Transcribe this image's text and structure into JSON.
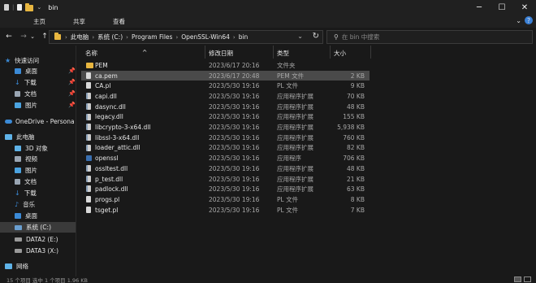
{
  "window": {
    "title": "bin",
    "controls": [
      "─",
      "☐",
      "✕"
    ]
  },
  "ribbon": {
    "tabs": [
      "主页",
      "共享",
      "查看"
    ],
    "expand": "⌄"
  },
  "nav": {
    "back": "←",
    "forward": "→",
    "recent": "⌄",
    "up": "↑",
    "breadcrumbs": [
      "此电脑",
      "系统 (C:)",
      "Program Files",
      "OpenSSL-Win64",
      "bin"
    ],
    "search_placeholder": "在 bin 中搜索"
  },
  "sidebar": {
    "quick_access": "快速访问",
    "pinned": [
      {
        "label": "桌面",
        "color": "#3b8ad6"
      },
      {
        "label": "下载",
        "color": "#3b8ad6"
      },
      {
        "label": "文档",
        "color": "#9aa6b3"
      },
      {
        "label": "图片",
        "color": "#4ba3e0"
      }
    ],
    "onedrive": "OneDrive - Persona",
    "this_pc": "此电脑",
    "pc_items": [
      {
        "label": "3D 对象",
        "color": "#5fb3e8"
      },
      {
        "label": "视频",
        "color": "#9aa6b3"
      },
      {
        "label": "图片",
        "color": "#4ba3e0"
      },
      {
        "label": "文档",
        "color": "#9aa6b3"
      },
      {
        "label": "下载",
        "color": "#3b8ad6"
      },
      {
        "label": "音乐",
        "color": "#3b8ad6"
      },
      {
        "label": "桌面",
        "color": "#3b8ad6"
      },
      {
        "label": "系统 (C:)",
        "color": "#6a9fd0"
      },
      {
        "label": "DATA2 (E:)",
        "color": "#9a9a9a"
      },
      {
        "label": "DATA3 (X:)",
        "color": "#9a9a9a"
      }
    ],
    "network": "网络"
  },
  "columns": {
    "name": "名称",
    "date": "修改日期",
    "type": "类型",
    "size": "大小"
  },
  "files": [
    {
      "name": "PEM",
      "date": "2023/6/17 20:16",
      "type": "文件夹",
      "size": "",
      "icon": "folder"
    },
    {
      "name": "ca.pem",
      "date": "2023/6/17 20:48",
      "type": "PEM 文件",
      "size": "2 KB",
      "icon": "doc"
    },
    {
      "name": "CA.pl",
      "date": "2023/5/30 19:16",
      "type": "PL 文件",
      "size": "9 KB",
      "icon": "doc"
    },
    {
      "name": "capi.dll",
      "date": "2023/5/30 19:16",
      "type": "应用程序扩展",
      "size": "70 KB",
      "icon": "dll"
    },
    {
      "name": "dasync.dll",
      "date": "2023/5/30 19:16",
      "type": "应用程序扩展",
      "size": "48 KB",
      "icon": "dll"
    },
    {
      "name": "legacy.dll",
      "date": "2023/5/30 19:16",
      "type": "应用程序扩展",
      "size": "155 KB",
      "icon": "dll"
    },
    {
      "name": "libcrypto-3-x64.dll",
      "date": "2023/5/30 19:16",
      "type": "应用程序扩展",
      "size": "5,938 KB",
      "icon": "dll"
    },
    {
      "name": "libssl-3-x64.dll",
      "date": "2023/5/30 19:16",
      "type": "应用程序扩展",
      "size": "760 KB",
      "icon": "dll"
    },
    {
      "name": "loader_attic.dll",
      "date": "2023/5/30 19:16",
      "type": "应用程序扩展",
      "size": "82 KB",
      "icon": "dll"
    },
    {
      "name": "openssl",
      "date": "2023/5/30 19:16",
      "type": "应用程序",
      "size": "706 KB",
      "icon": "exe"
    },
    {
      "name": "ossltest.dll",
      "date": "2023/5/30 19:16",
      "type": "应用程序扩展",
      "size": "48 KB",
      "icon": "dll"
    },
    {
      "name": "p_test.dll",
      "date": "2023/5/30 19:16",
      "type": "应用程序扩展",
      "size": "21 KB",
      "icon": "dll"
    },
    {
      "name": "padlock.dll",
      "date": "2023/5/30 19:16",
      "type": "应用程序扩展",
      "size": "63 KB",
      "icon": "dll"
    },
    {
      "name": "progs.pl",
      "date": "2023/5/30 19:16",
      "type": "PL 文件",
      "size": "8 KB",
      "icon": "doc"
    },
    {
      "name": "tsget.pl",
      "date": "2023/5/30 19:16",
      "type": "PL 文件",
      "size": "7 KB",
      "icon": "doc"
    }
  ],
  "highlighted_file": "ca.pem",
  "status": "15 个项目   选中 1 个项目  1.96 KB"
}
